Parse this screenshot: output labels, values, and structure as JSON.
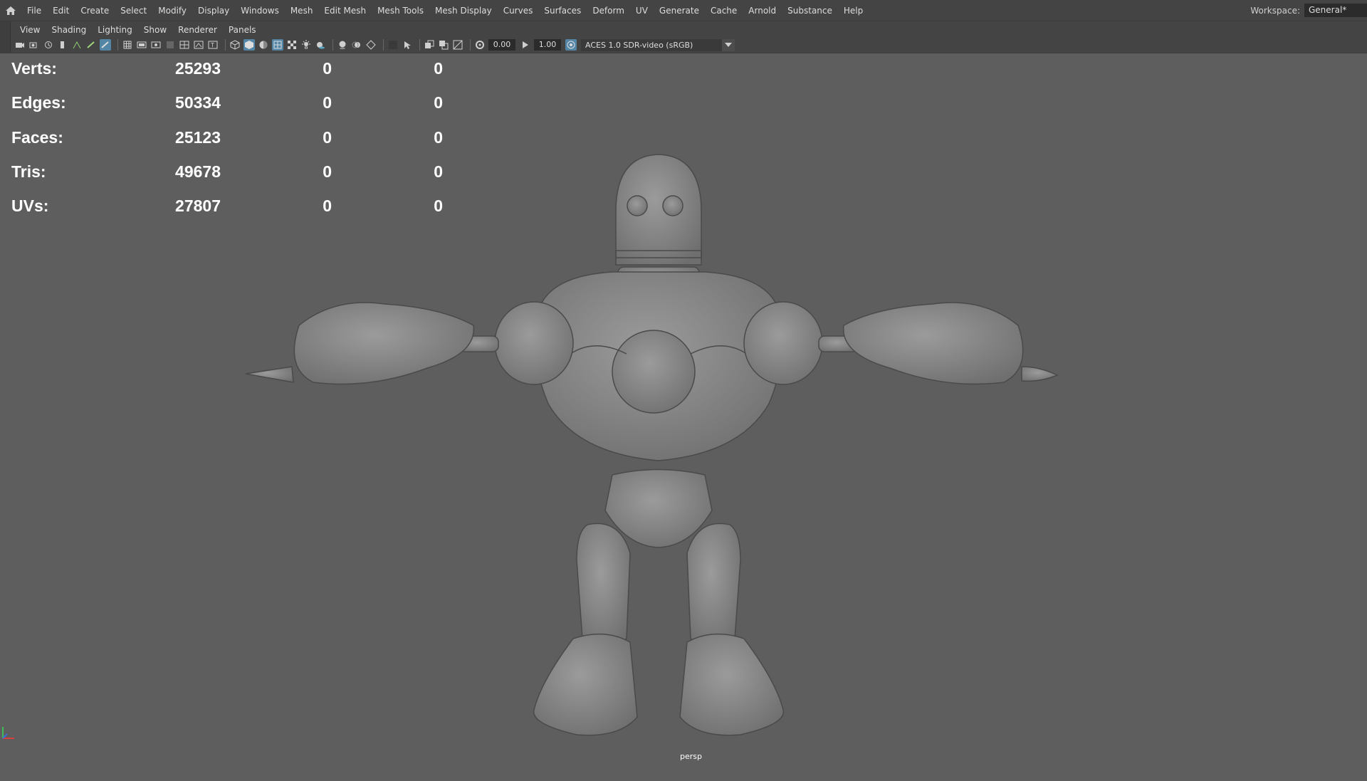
{
  "menubar": {
    "items": [
      "File",
      "Edit",
      "Create",
      "Select",
      "Modify",
      "Display",
      "Windows",
      "Mesh",
      "Edit Mesh",
      "Mesh Tools",
      "Mesh Display",
      "Curves",
      "Surfaces",
      "Deform",
      "UV",
      "Generate",
      "Cache",
      "Arnold",
      "Substance",
      "Help"
    ],
    "workspace_label": "Workspace:",
    "workspace_value": "General*"
  },
  "panel": {
    "menus": [
      "View",
      "Shading",
      "Lighting",
      "Show",
      "Renderer",
      "Panels"
    ],
    "field_1": "0.00",
    "field_2": "1.00",
    "color_space": "ACES 1.0 SDR-video (sRGB)"
  },
  "hud": {
    "rows": [
      {
        "label": "Verts:",
        "total": "25293",
        "selected": "0",
        "third": "0"
      },
      {
        "label": "Edges:",
        "total": "50334",
        "selected": "0",
        "third": "0"
      },
      {
        "label": "Faces:",
        "total": "25123",
        "selected": "0",
        "third": "0"
      },
      {
        "label": "Tris:",
        "total": "49678",
        "selected": "0",
        "third": "0"
      },
      {
        "label": "UVs:",
        "total": "27807",
        "selected": "0",
        "third": "0"
      }
    ]
  },
  "viewport": {
    "camera": "persp",
    "background_color": "#5e5e5e",
    "model_color": "#8a8a8a"
  },
  "colors": {
    "menubar_bg": "#444444",
    "active_icon": "#5285a6"
  }
}
